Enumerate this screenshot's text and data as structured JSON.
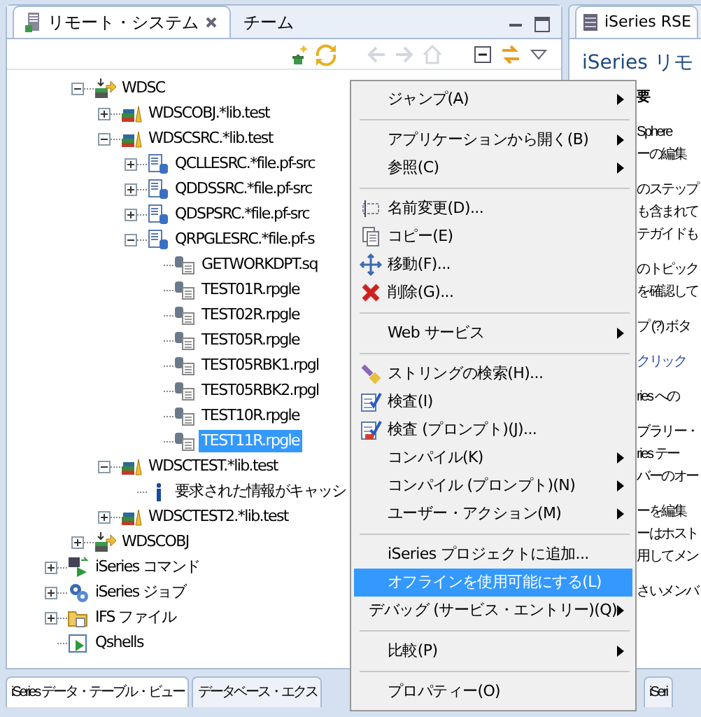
{
  "remote_view": {
    "tabs": [
      {
        "label": "リモート・システム",
        "selected": true,
        "closable": true
      },
      {
        "label": "チーム",
        "selected": false,
        "closable": false
      }
    ],
    "toolbar": [
      {
        "kind": "new-connection",
        "disabled": false
      },
      {
        "kind": "refresh",
        "disabled": false
      },
      {
        "kind": "back",
        "disabled": true
      },
      {
        "kind": "forward",
        "disabled": true
      },
      {
        "kind": "up",
        "disabled": true
      },
      {
        "kind": "collapse",
        "disabled": false
      },
      {
        "kind": "link",
        "disabled": false
      },
      {
        "kind": "menu",
        "disabled": false
      }
    ],
    "tree": {
      "scrolled_parent_children": [
        {
          "label": "WDSC",
          "kind": "filter",
          "expanded": true,
          "selected": false,
          "children": [
            {
              "label": "WDSCOBJ.*lib.test",
              "kind": "library",
              "expanded": false,
              "selected": false
            },
            {
              "label": "WDSCSRC.*lib.test",
              "kind": "library",
              "expanded": true,
              "selected": false,
              "children": [
                {
                  "label": "QCLLESRC.*file.pf-src",
                  "kind": "source-file",
                  "expanded": false,
                  "selected": false
                },
                {
                  "label": "QDDSSRC.*file.pf-src",
                  "kind": "source-file",
                  "expanded": false,
                  "selected": false
                },
                {
                  "label": "QDSPSRC.*file.pf-src",
                  "kind": "source-file",
                  "expanded": false,
                  "selected": false
                },
                {
                  "label": "QRPGLESRC.*file.pf-s",
                  "kind": "source-file",
                  "expanded": true,
                  "selected": false,
                  "children": [
                    {
                      "label": "GETWORKDPT.sq",
                      "kind": "member",
                      "selected": false
                    },
                    {
                      "label": "TEST01R.rpgle",
                      "kind": "member",
                      "selected": false
                    },
                    {
                      "label": "TEST02R.rpgle",
                      "kind": "member",
                      "selected": false
                    },
                    {
                      "label": "TEST05R.rpgle",
                      "kind": "member",
                      "selected": false
                    },
                    {
                      "label": "TEST05RBK1.rpgl",
                      "kind": "member",
                      "selected": false
                    },
                    {
                      "label": "TEST05RBK2.rpgl",
                      "kind": "member",
                      "selected": false
                    },
                    {
                      "label": "TEST10R.rpgle",
                      "kind": "member",
                      "selected": false
                    },
                    {
                      "label": "TEST11R.rpgle",
                      "kind": "member",
                      "selected": true
                    }
                  ]
                }
              ]
            },
            {
              "label": "WDSCTEST.*lib.test",
              "kind": "library",
              "expanded": true,
              "selected": false,
              "children": [
                {
                  "label": "要求された情報がキャッシ",
                  "kind": "info",
                  "selected": false
                }
              ]
            },
            {
              "label": "WDSCTEST2.*lib.test",
              "kind": "library",
              "expanded": false,
              "selected": false
            }
          ]
        },
        {
          "label": "WDSCOBJ",
          "kind": "filter",
          "expanded": false,
          "selected": false
        }
      ],
      "items": [
        {
          "label": "iSeries コマンド",
          "kind": "command",
          "expanded": false,
          "selected": false
        },
        {
          "label": "iSeries ジョブ",
          "kind": "job",
          "expanded": false,
          "selected": false
        },
        {
          "label": "IFS ファイル",
          "kind": "ifs",
          "expanded": false,
          "selected": false
        },
        {
          "label": "Qshells",
          "kind": "shell",
          "selected": false
        }
      ]
    }
  },
  "info_view": {
    "tab": "iSeries RSE",
    "heading": "iSeries リモ",
    "paragraphs": [
      [
        {
          "kind": "heading",
          "text": "要"
        }
      ],
      [
        {
          "kind": "text",
          "text": "Sphere"
        },
        {
          "kind": "text",
          "text": "ーの編集"
        }
      ],
      [
        {
          "kind": "text",
          "text": "のステップ"
        },
        {
          "kind": "text",
          "text": "も含まれて"
        },
        {
          "kind": "text",
          "text": "テガイドも"
        }
      ],
      [
        {
          "kind": "text",
          "text": "のトピック"
        },
        {
          "kind": "text",
          "text": "を確認して"
        }
      ],
      [
        {
          "kind": "text",
          "text": "プ (?) ボタ"
        }
      ],
      [
        {
          "kind": "link",
          "text": "クリック"
        }
      ],
      [
        {
          "kind": "text",
          "text": "ries への"
        }
      ],
      [
        {
          "kind": "text",
          "text": "ブラリー・"
        },
        {
          "kind": "text",
          "text": "ries テー"
        },
        {
          "kind": "text",
          "text": "バーのオー"
        }
      ],
      [
        {
          "kind": "text",
          "text": "ーを編集"
        },
        {
          "kind": "text",
          "text": "ーはホスト"
        },
        {
          "kind": "text",
          "text": "用してメン"
        }
      ],
      [
        {
          "kind": "text",
          "text": "さいメンバ"
        }
      ]
    ]
  },
  "bottom_tabs": {
    "left": [
      {
        "label": "iSeries データ・テーブル・ビュー",
        "selected": true
      },
      {
        "label": "データベース・エクス",
        "selected": false
      }
    ],
    "right": [
      {
        "label": "iSeri",
        "selected": false
      }
    ]
  },
  "context_menu": {
    "items": [
      {
        "kind": "plain",
        "label": "ジャンプ(A)",
        "submenu": true,
        "selected": false
      },
      {
        "kind": "separator"
      },
      {
        "kind": "plain",
        "label": "アプリケーションから開く(B)",
        "submenu": true,
        "selected": false
      },
      {
        "kind": "plain",
        "label": "参照(C)",
        "submenu": true,
        "selected": false
      },
      {
        "kind": "separator"
      },
      {
        "kind": "rename",
        "label": "名前変更(D)...",
        "submenu": false,
        "selected": false
      },
      {
        "kind": "copy",
        "label": "コピー(E)",
        "submenu": false,
        "selected": false
      },
      {
        "kind": "move",
        "label": "移動(F)...",
        "submenu": false,
        "selected": false
      },
      {
        "kind": "delete",
        "label": "削除(G)...",
        "submenu": false,
        "selected": false
      },
      {
        "kind": "separator"
      },
      {
        "kind": "plain",
        "label": "Web サービス",
        "submenu": true,
        "selected": false
      },
      {
        "kind": "separator"
      },
      {
        "kind": "search",
        "label": "ストリングの検索(H)...",
        "submenu": false,
        "selected": false
      },
      {
        "kind": "verify",
        "label": "検査(I)",
        "submenu": false,
        "selected": false
      },
      {
        "kind": "verify-prompt",
        "label": "検査 (プロンプト)(J)...",
        "submenu": false,
        "selected": false
      },
      {
        "kind": "plain",
        "label": "コンパイル(K)",
        "submenu": true,
        "selected": false
      },
      {
        "kind": "plain",
        "label": "コンパイル (プロンプト)(N)",
        "submenu": true,
        "selected": false
      },
      {
        "kind": "plain",
        "label": "ユーザー・アクション(M)",
        "submenu": true,
        "selected": false
      },
      {
        "kind": "separator"
      },
      {
        "kind": "plain",
        "label": "iSeries プロジェクトに追加...",
        "submenu": false,
        "selected": false
      },
      {
        "kind": "plain",
        "label": "オフラインを使用可能にする(L)",
        "submenu": false,
        "selected": true
      },
      {
        "kind": "plain",
        "label": "デバッグ (サービス・エントリー)(Q)",
        "submenu": true,
        "selected": false
      },
      {
        "kind": "separator"
      },
      {
        "kind": "plain",
        "label": "比較(P)",
        "submenu": true,
        "selected": false
      },
      {
        "kind": "separator"
      },
      {
        "kind": "plain",
        "label": "プロパティー(O)",
        "submenu": false,
        "selected": false
      }
    ]
  }
}
